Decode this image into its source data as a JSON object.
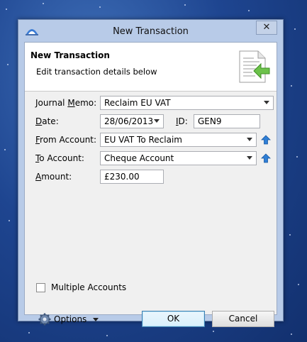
{
  "window": {
    "title": "New Transaction",
    "close_glyph": "✕"
  },
  "header": {
    "title": "New Transaction",
    "subtitle": "Edit transaction details below"
  },
  "form": {
    "journal_memo": {
      "label_pre": "Journal ",
      "label_ul": "M",
      "label_post": "emo:",
      "value": "Reclaim EU VAT"
    },
    "date": {
      "label_ul": "D",
      "label_post": "ate:",
      "value": "28/06/2013"
    },
    "id": {
      "label_ul": "I",
      "label_post": "D:",
      "value": "GEN9"
    },
    "from_account": {
      "label_ul": "F",
      "label_post": "rom Account:",
      "value": "EU VAT To Reclaim"
    },
    "to_account": {
      "label_ul": "T",
      "label_post": "o Account:",
      "value": "Cheque Account"
    },
    "amount": {
      "label_ul": "A",
      "label_post": "mount:",
      "value": "£230.00"
    }
  },
  "multiple_accounts": {
    "label": "Multiple Accounts",
    "checked": false
  },
  "footer": {
    "options_label": "Options",
    "ok_label": "OK",
    "cancel_label": "Cancel"
  },
  "colors": {
    "accent": "#3c7fb1",
    "background": "#f0f0f0",
    "arrow_icon": "#2f7fd6"
  }
}
